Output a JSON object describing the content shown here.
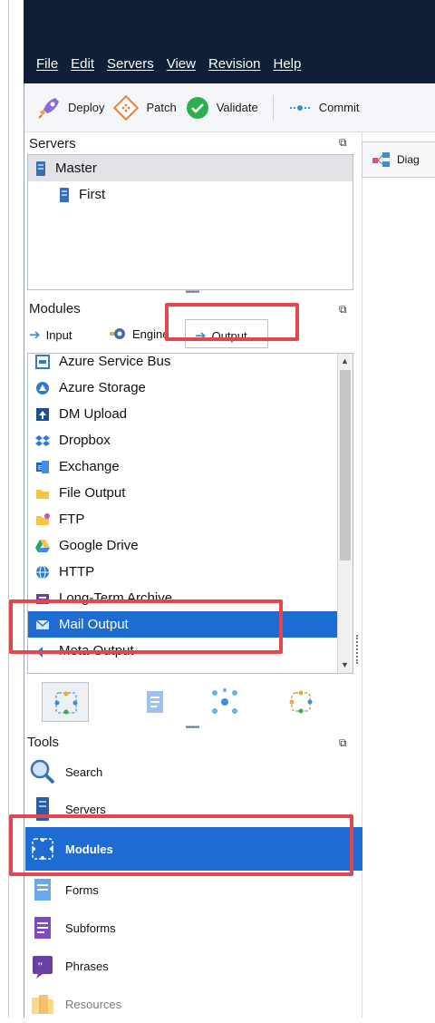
{
  "menu": [
    "File",
    "Edit",
    "Servers",
    "View",
    "Revision",
    "Help"
  ],
  "toolbar": {
    "deploy": "Deploy",
    "patch": "Patch",
    "validate": "Validate",
    "commit": "Commit"
  },
  "servers": {
    "title": "Servers",
    "items": [
      "Master",
      "First"
    ]
  },
  "modules": {
    "title": "Modules",
    "tabs": [
      "Input",
      "Engine",
      "Output"
    ],
    "items": [
      "Azure Service Bus",
      "Azure Storage",
      "DM Upload",
      "Dropbox",
      "Exchange",
      "File Output",
      "FTP",
      "Google Drive",
      "HTTP",
      "Long-Term Archive",
      "Mail Output",
      "Meta Output"
    ]
  },
  "tools": {
    "title": "Tools",
    "items": [
      "Search",
      "Servers",
      "Modules",
      "Forms",
      "Subforms",
      "Phrases",
      "Resources"
    ]
  },
  "document_tab": {
    "label": "Diag"
  },
  "colors": {
    "topbar": "#0f2036",
    "highlight": "#1c6cd4",
    "annotation": "#e3474d"
  }
}
